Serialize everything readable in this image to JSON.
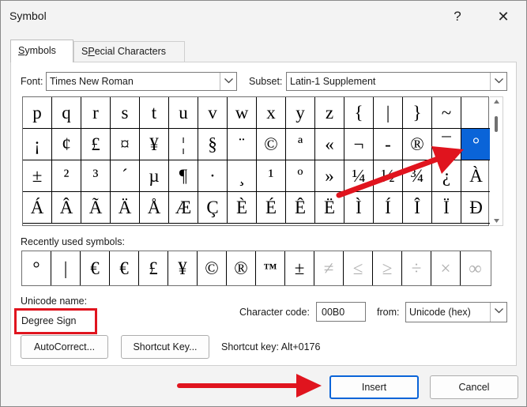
{
  "window": {
    "title": "Symbol",
    "help_label": "?",
    "close_label": "✕"
  },
  "tabs": [
    {
      "label": "Symbols",
      "accel": "S",
      "rest": "ymbols",
      "active": true
    },
    {
      "label": "Special Characters",
      "accel": "P",
      "pre": "S",
      "rest": "ecial Characters",
      "active": false
    }
  ],
  "font": {
    "label": "Font:",
    "value": "Times New Roman"
  },
  "subset": {
    "label": "Subset:",
    "value": "Latin-1 Supplement"
  },
  "symbol_grid": {
    "rows": [
      [
        "p",
        "q",
        "r",
        "s",
        "t",
        "u",
        "v",
        "w",
        "x",
        "y",
        "z",
        "{",
        "|",
        "}",
        "~",
        ""
      ],
      [
        "¡",
        "¢",
        "£",
        "¤",
        "¥",
        "¦",
        "§",
        "¨",
        "©",
        "ª",
        "«",
        "¬",
        "-",
        "®",
        "¯",
        "°"
      ],
      [
        "±",
        "²",
        "³",
        "´",
        "µ",
        "¶",
        "·",
        "¸",
        "¹",
        "º",
        "»",
        "¼",
        "½",
        "¾",
        "¿",
        "À"
      ],
      [
        "Á",
        "Â",
        "Ã",
        "Ä",
        "Å",
        "Æ",
        "Ç",
        "È",
        "É",
        "Ê",
        "Ë",
        "Ì",
        "Í",
        "Î",
        "Ï",
        "Ð"
      ]
    ],
    "selected_symbol": "°"
  },
  "recent": {
    "label": "Recently used symbols:",
    "symbols": [
      "°",
      "|",
      "€",
      "€",
      "£",
      "¥",
      "©",
      "®",
      "™",
      "±",
      "≠",
      "≤",
      "≥",
      "÷",
      "×",
      "∞"
    ]
  },
  "unicode_name": {
    "label": "Unicode name:",
    "value": "Degree Sign"
  },
  "char_code": {
    "label": "Character code:",
    "value": "00B0"
  },
  "from": {
    "label": "from:",
    "value": "Unicode (hex)"
  },
  "buttons": {
    "autocorrect": "AutoCorrect...",
    "shortcut_key": "Shortcut Key...",
    "insert": "Insert",
    "cancel": "Cancel"
  },
  "shortcut_text": "Shortcut key: Alt+0176",
  "colors": {
    "accent": "#0a64d8",
    "annotation_red": "#e0141e"
  },
  "icons": [
    "help-icon",
    "close-icon",
    "chevron-down-icon",
    "scroll-up-arrow-icon",
    "scroll-down-arrow-icon"
  ]
}
